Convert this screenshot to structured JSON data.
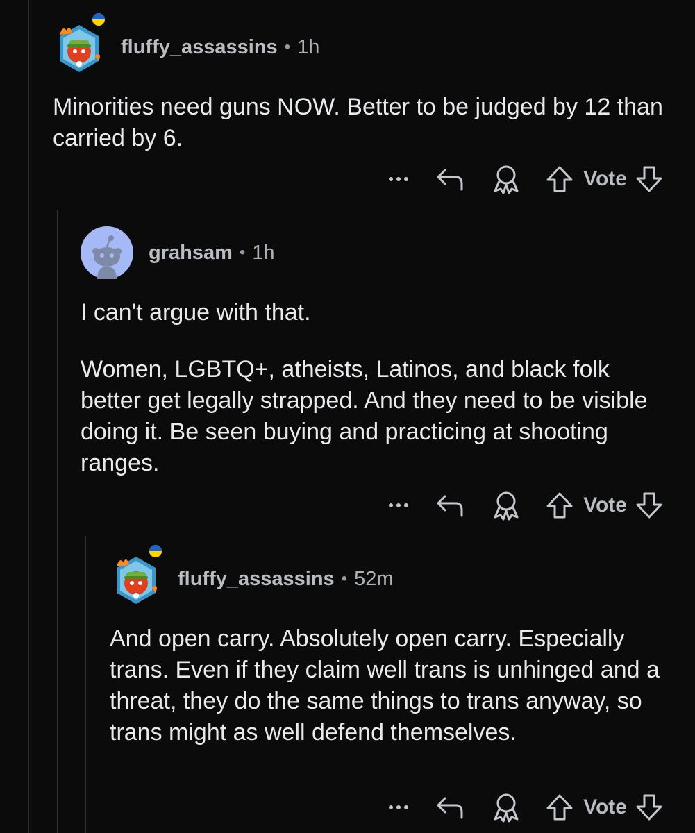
{
  "comments": [
    {
      "username": "fluffy_assassins",
      "separator": "•",
      "age": "1h",
      "paragraphs": [
        "Minorities need guns NOW. Better to be judged by 12 than carried by 6."
      ],
      "actions": {
        "vote_label": "Vote"
      }
    },
    {
      "username": "grahsam",
      "separator": "•",
      "age": "1h",
      "paragraphs": [
        "I can't argue with that.",
        "Women, LGBTQ+, atheists, Latinos, and black folk better get legally strapped. And they need to be visible doing it. Be seen buying and practicing at shooting ranges."
      ],
      "actions": {
        "vote_label": "Vote"
      }
    },
    {
      "username": "fluffy_assassins",
      "separator": "•",
      "age": "52m",
      "paragraphs": [
        "And open carry. Absolutely open carry. Especially trans. Even if they claim well trans is unhinged and a threat, they do the same things to trans anyway, so trans might as well defend themselves."
      ],
      "actions": {
        "vote_label": "Vote"
      }
    }
  ],
  "colors": {
    "background": "#0b0b0c",
    "thread_line": "#2e3033",
    "text": "#e9eaec",
    "muted": "#aeb1b6",
    "snoo_avatar_bg": "#a6b9f7"
  },
  "icons": [
    "avatar-hexagon-icon",
    "ukraine-flag-badge-icon",
    "snoo-avatar-icon",
    "more-options-icon",
    "reply-icon",
    "award-icon",
    "upvote-icon",
    "downvote-icon"
  ]
}
